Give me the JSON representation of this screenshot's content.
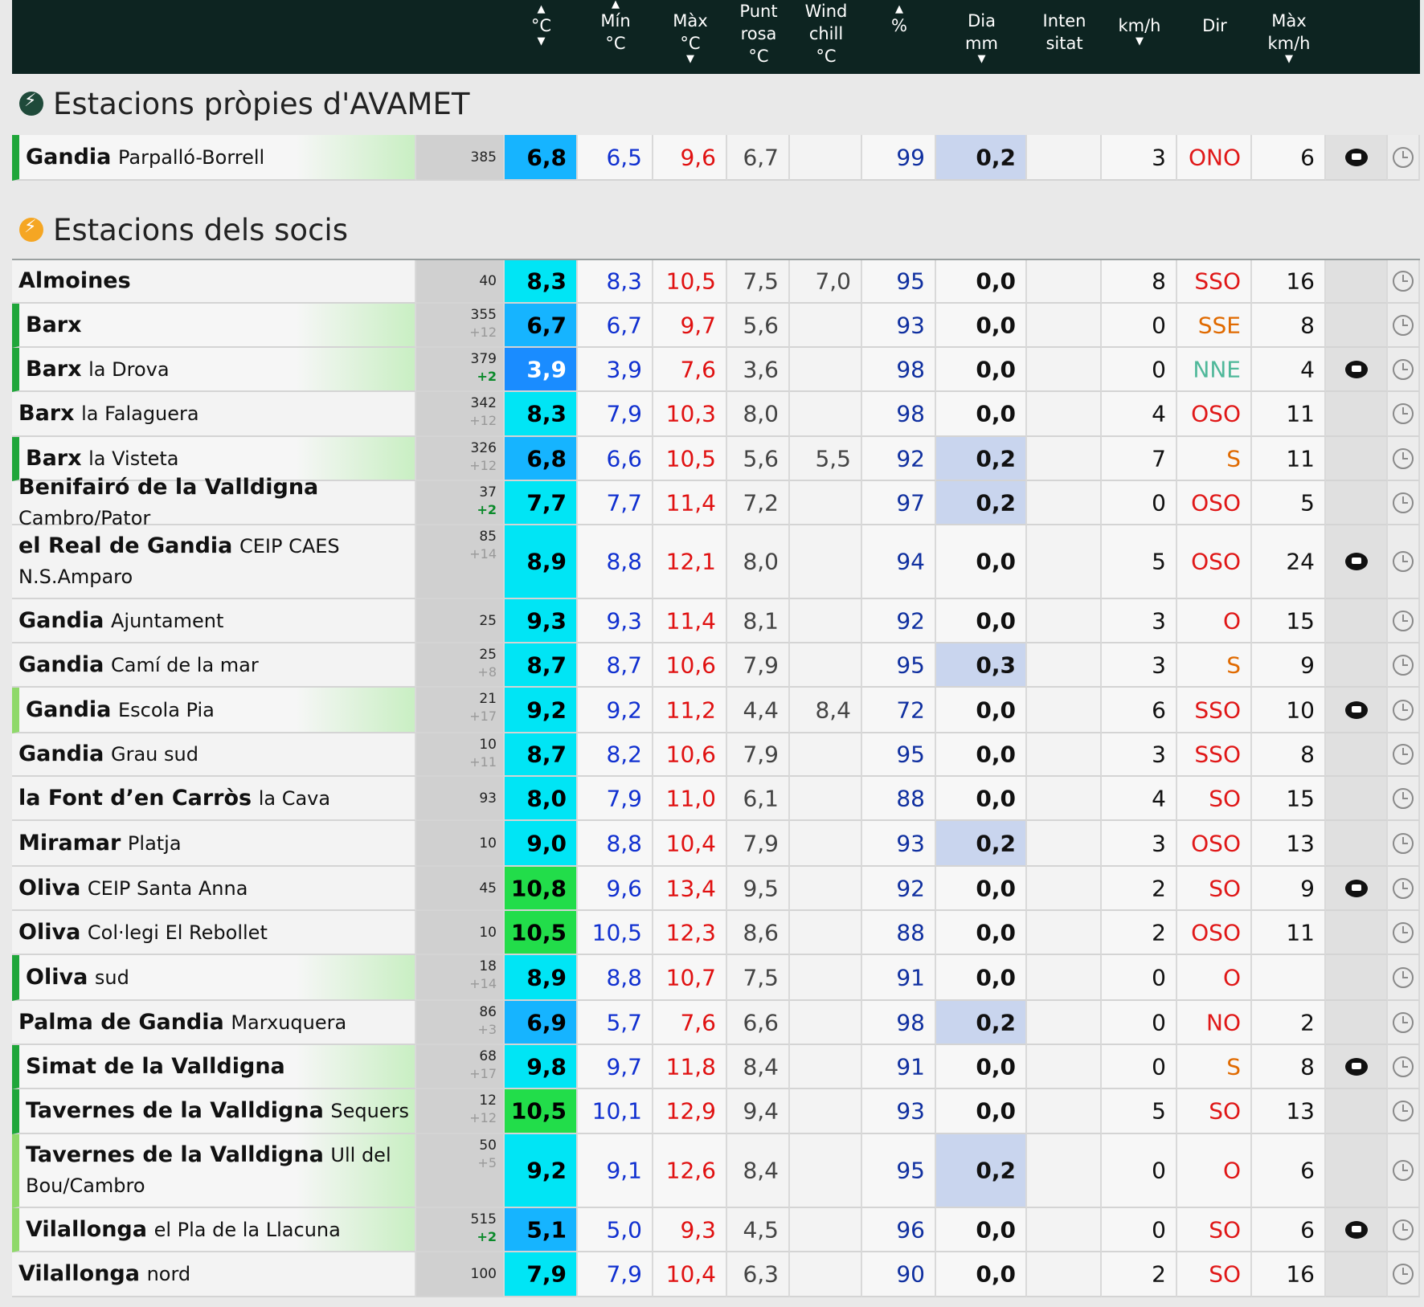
{
  "header": {
    "cols": [
      {
        "key": "temp",
        "lines": [
          "°C"
        ],
        "up": true,
        "down": true
      },
      {
        "key": "min",
        "lines": [
          "Mín",
          "°C"
        ],
        "up": true,
        "down": false
      },
      {
        "key": "max",
        "lines": [
          "Màx",
          "°C"
        ],
        "up": false,
        "down": true
      },
      {
        "key": "dew",
        "lines": [
          "Punt",
          "rosa",
          "°C"
        ],
        "up": false,
        "down": false
      },
      {
        "key": "wc",
        "lines": [
          "Wind",
          "chill",
          "°C"
        ],
        "up": false,
        "down": false
      },
      {
        "key": "hum",
        "lines": [
          "%"
        ],
        "up": true,
        "down": false
      },
      {
        "key": "rain",
        "lines": [
          "Dia",
          "mm"
        ],
        "up": false,
        "down": true
      },
      {
        "key": "int",
        "lines": [
          "Inten",
          "sitat"
        ],
        "up": false,
        "down": false
      },
      {
        "key": "wind",
        "lines": [
          "km/h"
        ],
        "up": false,
        "down": true
      },
      {
        "key": "dir",
        "lines": [
          "Dir"
        ],
        "up": false,
        "down": false
      },
      {
        "key": "gust",
        "lines": [
          "Màx",
          "km/h"
        ],
        "up": false,
        "down": true
      }
    ]
  },
  "sections": {
    "own": {
      "title": "Estacions pròpies d'AVAMET",
      "icon_color": "#1f4a3a"
    },
    "members": {
      "title": "Estacions dels socis",
      "icon_color": "#f5a623"
    }
  },
  "colors": {
    "very_cold": "#1a8cff",
    "cold": "#16b4ff",
    "cool": "#00e5f5",
    "warm": "#22dd4a",
    "dir_orange": "#e06a00",
    "dir_red": "#e01818",
    "dir_teal": "#4fb89a",
    "rain_bg": "#c9d5ee"
  },
  "own_stations": [
    {
      "name": "Gandia",
      "sub": "Parpalló-Borrell",
      "alt": "385",
      "alt2": "",
      "t": "6,8",
      "min": "6,5",
      "max": "9,6",
      "dew": "6,7",
      "wc": "",
      "hum": "99",
      "rain": "0,2",
      "int": "",
      "wind": "3",
      "dir": "ONO",
      "gust": "6",
      "cam": true,
      "stripe": "g"
    }
  ],
  "member_stations": [
    {
      "name": "Almoines",
      "sub": "",
      "alt": "40",
      "alt2": "",
      "t": "8,3",
      "min": "8,3",
      "max": "10,5",
      "dew": "7,5",
      "wc": "7,0",
      "hum": "95",
      "rain": "0,0",
      "int": "",
      "wind": "8",
      "dir": "SSO",
      "gust": "16",
      "cam": false,
      "stripe": ""
    },
    {
      "name": "Barx",
      "sub": "",
      "alt": "355",
      "alt2": "+12",
      "t": "6,7",
      "min": "6,7",
      "max": "9,7",
      "dew": "5,6",
      "wc": "",
      "hum": "93",
      "rain": "0,0",
      "int": "",
      "wind": "0",
      "dir": "SSE",
      "gust": "8",
      "cam": false,
      "stripe": "g"
    },
    {
      "name": "Barx",
      "sub": "la Drova",
      "alt": "379",
      "alt2": "+2",
      "t": "3,9",
      "min": "3,9",
      "max": "7,6",
      "dew": "3,6",
      "wc": "",
      "hum": "98",
      "rain": "0,0",
      "int": "",
      "wind": "0",
      "dir": "NNE",
      "gust": "4",
      "cam": true,
      "stripe": "g"
    },
    {
      "name": "Barx",
      "sub": "la Falaguera",
      "alt": "342",
      "alt2": "+12",
      "t": "8,3",
      "min": "7,9",
      "max": "10,3",
      "dew": "8,0",
      "wc": "",
      "hum": "98",
      "rain": "0,0",
      "int": "",
      "wind": "4",
      "dir": "OSO",
      "gust": "11",
      "cam": false,
      "stripe": ""
    },
    {
      "name": "Barx",
      "sub": "la Visteta",
      "alt": "326",
      "alt2": "+12",
      "t": "6,8",
      "min": "6,6",
      "max": "10,5",
      "dew": "5,6",
      "wc": "5,5",
      "hum": "92",
      "rain": "0,2",
      "int": "",
      "wind": "7",
      "dir": "S",
      "gust": "11",
      "cam": false,
      "stripe": "g"
    },
    {
      "name": "Benifairó de la Valldigna",
      "sub": "Cambro/Pator",
      "alt": "37",
      "alt2": "+2",
      "t": "7,7",
      "min": "7,7",
      "max": "11,4",
      "dew": "7,2",
      "wc": "",
      "hum": "97",
      "rain": "0,2",
      "int": "",
      "wind": "0",
      "dir": "OSO",
      "gust": "5",
      "cam": false,
      "stripe": ""
    },
    {
      "name": "el Real de Gandia",
      "sub": "CEIP CAES N.S.Amparo",
      "alt": "85",
      "alt2": "+14",
      "t": "8,9",
      "min": "8,8",
      "max": "12,1",
      "dew": "8,0",
      "wc": "",
      "hum": "94",
      "rain": "0,0",
      "int": "",
      "wind": "5",
      "dir": "OSO",
      "gust": "24",
      "cam": true,
      "stripe": ""
    },
    {
      "name": "Gandia",
      "sub": "Ajuntament",
      "alt": "25",
      "alt2": "",
      "t": "9,3",
      "min": "9,3",
      "max": "11,4",
      "dew": "8,1",
      "wc": "",
      "hum": "92",
      "rain": "0,0",
      "int": "",
      "wind": "3",
      "dir": "O",
      "gust": "15",
      "cam": false,
      "stripe": ""
    },
    {
      "name": "Gandia",
      "sub": "Camí de la mar",
      "alt": "25",
      "alt2": "+8",
      "t": "8,7",
      "min": "8,7",
      "max": "10,6",
      "dew": "7,9",
      "wc": "",
      "hum": "95",
      "rain": "0,3",
      "int": "",
      "wind": "3",
      "dir": "S",
      "gust": "9",
      "cam": false,
      "stripe": ""
    },
    {
      "name": "Gandia",
      "sub": "Escola Pia",
      "alt": "21",
      "alt2": "+17",
      "t": "9,2",
      "min": "9,2",
      "max": "11,2",
      "dew": "4,4",
      "wc": "8,4",
      "hum": "72",
      "rain": "0,0",
      "int": "",
      "wind": "6",
      "dir": "SSO",
      "gust": "10",
      "cam": true,
      "stripe": "lg"
    },
    {
      "name": "Gandia",
      "sub": "Grau sud",
      "alt": "10",
      "alt2": "+11",
      "t": "8,7",
      "min": "8,2",
      "max": "10,6",
      "dew": "7,9",
      "wc": "",
      "hum": "95",
      "rain": "0,0",
      "int": "",
      "wind": "3",
      "dir": "SSO",
      "gust": "8",
      "cam": false,
      "stripe": ""
    },
    {
      "name": "la Font d’en Carròs",
      "sub": "la Cava",
      "alt": "93",
      "alt2": "",
      "t": "8,0",
      "min": "7,9",
      "max": "11,0",
      "dew": "6,1",
      "wc": "",
      "hum": "88",
      "rain": "0,0",
      "int": "",
      "wind": "4",
      "dir": "SO",
      "gust": "15",
      "cam": false,
      "stripe": ""
    },
    {
      "name": "Miramar",
      "sub": "Platja",
      "alt": "10",
      "alt2": "",
      "t": "9,0",
      "min": "8,8",
      "max": "10,4",
      "dew": "7,9",
      "wc": "",
      "hum": "93",
      "rain": "0,2",
      "int": "",
      "wind": "3",
      "dir": "OSO",
      "gust": "13",
      "cam": false,
      "stripe": ""
    },
    {
      "name": "Oliva",
      "sub": "CEIP Santa Anna",
      "alt": "45",
      "alt2": "",
      "t": "10,8",
      "min": "9,6",
      "max": "13,4",
      "dew": "9,5",
      "wc": "",
      "hum": "92",
      "rain": "0,0",
      "int": "",
      "wind": "2",
      "dir": "SO",
      "gust": "9",
      "cam": true,
      "stripe": ""
    },
    {
      "name": "Oliva",
      "sub": "Col·legi El Rebollet",
      "alt": "10",
      "alt2": "",
      "t": "10,5",
      "min": "10,5",
      "max": "12,3",
      "dew": "8,6",
      "wc": "",
      "hum": "88",
      "rain": "0,0",
      "int": "",
      "wind": "2",
      "dir": "OSO",
      "gust": "11",
      "cam": false,
      "stripe": ""
    },
    {
      "name": "Oliva",
      "sub": "sud",
      "alt": "18",
      "alt2": "+14",
      "t": "8,9",
      "min": "8,8",
      "max": "10,7",
      "dew": "7,5",
      "wc": "",
      "hum": "91",
      "rain": "0,0",
      "int": "",
      "wind": "0",
      "dir": "O",
      "gust": "",
      "cam": false,
      "stripe": "g"
    },
    {
      "name": "Palma de Gandia",
      "sub": "Marxuquera",
      "alt": "86",
      "alt2": "+3",
      "t": "6,9",
      "min": "5,7",
      "max": "7,6",
      "dew": "6,6",
      "wc": "",
      "hum": "98",
      "rain": "0,2",
      "int": "",
      "wind": "0",
      "dir": "NO",
      "gust": "2",
      "cam": false,
      "stripe": ""
    },
    {
      "name": "Simat de la Valldigna",
      "sub": "",
      "alt": "68",
      "alt2": "+17",
      "t": "9,8",
      "min": "9,7",
      "max": "11,8",
      "dew": "8,4",
      "wc": "",
      "hum": "91",
      "rain": "0,0",
      "int": "",
      "wind": "0",
      "dir": "S",
      "gust": "8",
      "cam": true,
      "stripe": "g"
    },
    {
      "name": "Tavernes de la Valldigna",
      "sub": "Sequers",
      "alt": "12",
      "alt2": "+12",
      "t": "10,5",
      "min": "10,1",
      "max": "12,9",
      "dew": "9,4",
      "wc": "",
      "hum": "93",
      "rain": "0,0",
      "int": "",
      "wind": "5",
      "dir": "SO",
      "gust": "13",
      "cam": false,
      "stripe": "g"
    },
    {
      "name": "Tavernes de la Valldigna",
      "sub": "Ull del Bou/Cambro",
      "alt": "50",
      "alt2": "+5",
      "t": "9,2",
      "min": "9,1",
      "max": "12,6",
      "dew": "8,4",
      "wc": "",
      "hum": "95",
      "rain": "0,2",
      "int": "",
      "wind": "0",
      "dir": "O",
      "gust": "6",
      "cam": false,
      "stripe": "lg"
    },
    {
      "name": "Vilallonga",
      "sub": "el Pla de la Llacuna",
      "alt": "515",
      "alt2": "+2",
      "t": "5,1",
      "min": "5,0",
      "max": "9,3",
      "dew": "4,5",
      "wc": "",
      "hum": "96",
      "rain": "0,0",
      "int": "",
      "wind": "0",
      "dir": "SO",
      "gust": "6",
      "cam": true,
      "stripe": "lg"
    },
    {
      "name": "Vilallonga",
      "sub": "nord",
      "alt": "100",
      "alt2": "",
      "t": "7,9",
      "min": "7,9",
      "max": "10,4",
      "dew": "6,3",
      "wc": "",
      "hum": "90",
      "rain": "0,0",
      "int": "",
      "wind": "2",
      "dir": "SO",
      "gust": "16",
      "cam": false,
      "stripe": ""
    }
  ]
}
